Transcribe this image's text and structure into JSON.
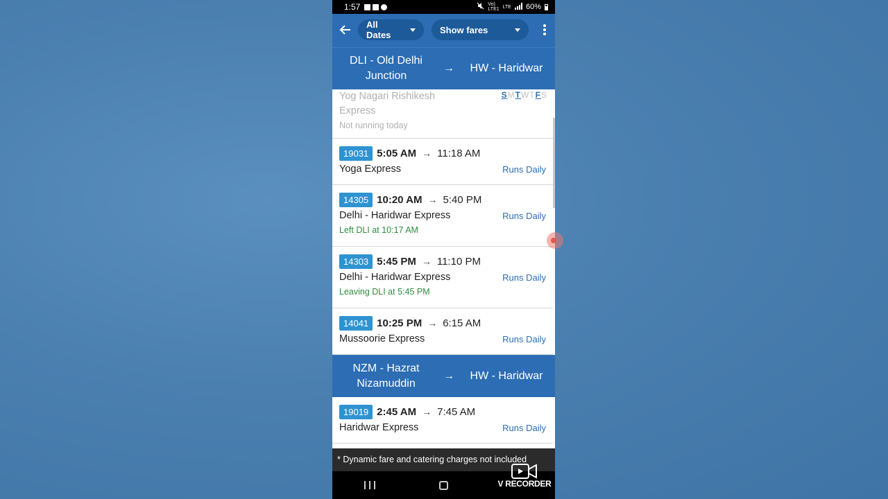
{
  "status_bar": {
    "time": "1:57",
    "network_top": "Vo)",
    "network_bottom": "LTE1",
    "lte_label": "LTE",
    "battery": "60%"
  },
  "app_bar": {
    "date_filter": "All Dates",
    "fare_filter": "Show fares"
  },
  "routes": [
    {
      "from": "DLI - Old Delhi Junction",
      "arrow": "→",
      "to": "HW - Haridwar",
      "trains": [
        {
          "name": "Yog Nagari Rishikesh Express",
          "status": "Not running today",
          "days": [
            "S",
            "M",
            "T",
            "W",
            "T",
            "F",
            "S"
          ],
          "running_days": [
            0,
            2,
            5
          ]
        },
        {
          "number": "19031",
          "departure": "5:05 AM",
          "arrival": "11:18 AM",
          "name": "Yoga Express",
          "runs": "Runs Daily"
        },
        {
          "number": "14305",
          "departure": "10:20 AM",
          "arrival": "5:40 PM",
          "name": "Delhi - Haridwar Express",
          "runs": "Runs Daily",
          "live": "Left DLI at 10:17 AM"
        },
        {
          "number": "14303",
          "departure": "5:45 PM",
          "arrival": "11:10 PM",
          "name": "Delhi - Haridwar Express",
          "runs": "Runs Daily",
          "live": "Leaving DLI at 5:45 PM"
        },
        {
          "number": "14041",
          "departure": "10:25 PM",
          "arrival": "6:15 AM",
          "name": "Mussoorie Express",
          "runs": "Runs Daily"
        }
      ]
    },
    {
      "from": "NZM - Hazrat Nizamuddin",
      "arrow": "→",
      "to": "HW - Haridwar",
      "trains": [
        {
          "number": "19019",
          "departure": "2:45 AM",
          "arrival": "7:45 AM",
          "name": "Haridwar Express",
          "runs": "Runs Daily"
        }
      ]
    }
  ],
  "footer_note": "* Dynamic fare and catering charges not included",
  "watermark": "V RECORDER",
  "colors": {
    "primary": "#2c6db3",
    "chip": "#1d5a99",
    "train_badge": "#2f93d1",
    "live_green": "#2e8b3e"
  }
}
